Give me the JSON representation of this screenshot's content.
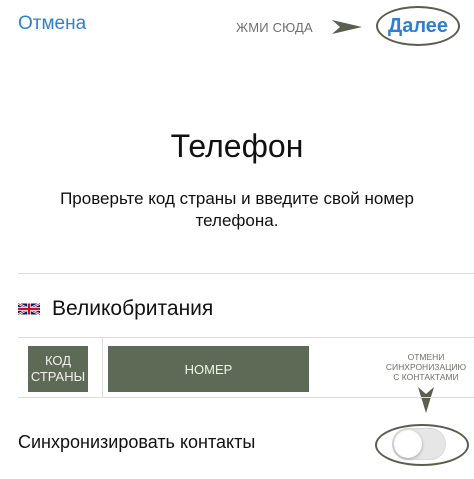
{
  "nav": {
    "cancel_label": "Отмена",
    "hint_text": "ЖМИ СЮДА",
    "next_label": "Далее"
  },
  "header": {
    "title": "Телефон",
    "subtitle": "Проверьте код страны и введите свой номер телефона."
  },
  "country": {
    "flag_icon": "uk-flag-icon",
    "name": "Великобритания"
  },
  "phone": {
    "code_line1": "КОД",
    "code_line2": "СТРАНЫ",
    "number_label": "НОМЕР"
  },
  "sync": {
    "hint_line1": "ОТМЕНИ",
    "hint_line2": "СИНХРОНИЗАЦИЮ",
    "hint_line3": "С КОНТАКТАМИ",
    "label": "Синхронизировать контакты",
    "enabled": false
  },
  "colors": {
    "accent": "#2e7fd1",
    "overlay_field": "#5d6a55",
    "annotation": "#5a5e4e"
  }
}
